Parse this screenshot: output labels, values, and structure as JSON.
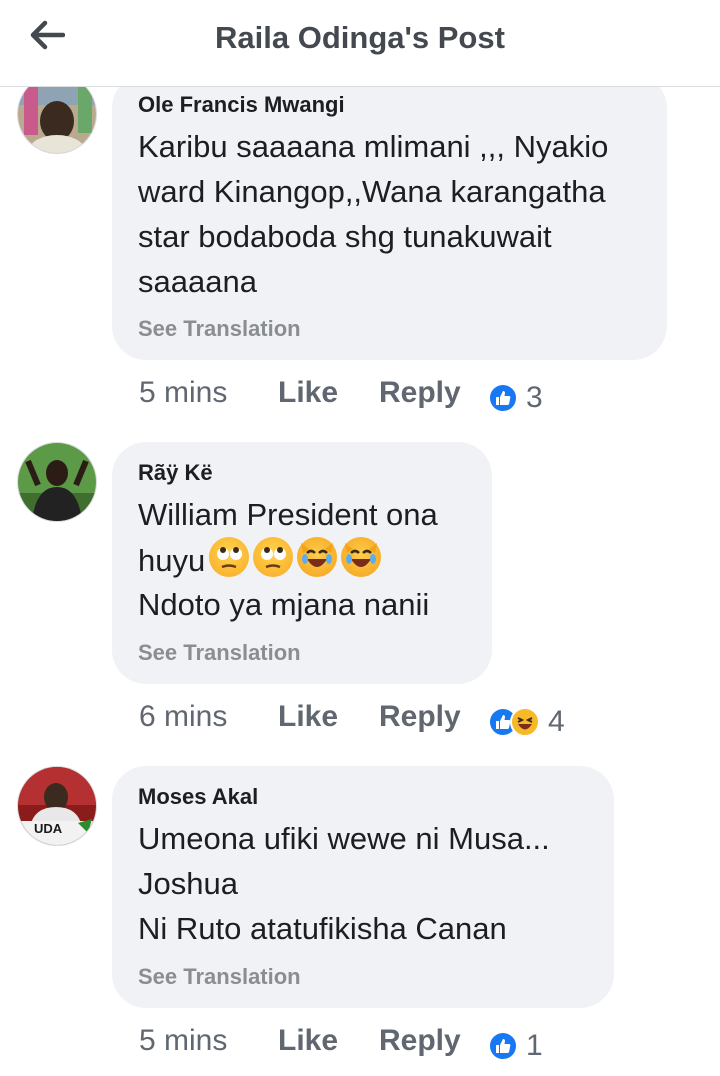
{
  "header": {
    "title": "Raila Odinga's Post"
  },
  "comments": [
    {
      "author": "Ole Francis Mwangi",
      "lines": [
        "Karibu saaaana mlimani ,,, Nyakio",
        "ward Kinangop,,Wana karangatha",
        "star bodaboda shg tunakuwait",
        "saaaana"
      ],
      "see_translation": "See Translation",
      "time": "5 mins",
      "like": "Like",
      "reply": "Reply",
      "reaction_count": "3",
      "reactions": [
        "like-icon"
      ]
    },
    {
      "author": "Rãÿ Kë",
      "lines": [
        "William President ona",
        "huyu",
        "Ndoto ya mjana nanii"
      ],
      "emojis": [
        "face-with-rolling-eyes",
        "face-with-rolling-eyes",
        "crying-laughing-cat",
        "crying-laughing-cat"
      ],
      "see_translation": "See Translation",
      "time": "6 mins",
      "like": "Like",
      "reply": "Reply",
      "reaction_count": "4",
      "reactions": [
        "like-icon",
        "haha-icon"
      ]
    },
    {
      "author": "Moses Akal",
      "lines": [
        "Umeona ufiki wewe ni Musa...",
        "Joshua",
        "Ni Ruto atatufikisha Canan"
      ],
      "avatar_text": "UDA",
      "see_translation": "See Translation",
      "time": "5 mins",
      "like": "Like",
      "reply": "Reply",
      "reaction_count": "1",
      "reactions": [
        "like-icon"
      ]
    }
  ],
  "colors": {
    "bubble": "#f0f2f5",
    "like_blue": "#1877f2",
    "muted": "#606770",
    "translate": "#8a8d91"
  }
}
